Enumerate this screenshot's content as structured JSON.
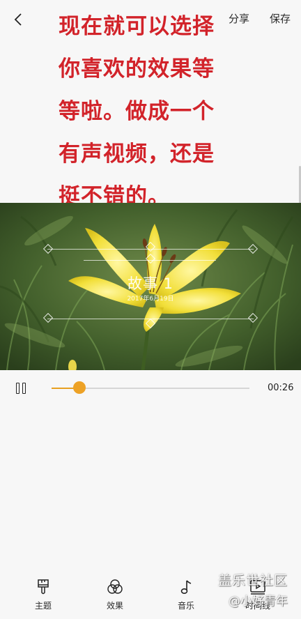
{
  "header": {
    "share_label": "分享",
    "save_label": "保存"
  },
  "overlay_text": [
    "现在就可以选择",
    "你喜欢的效果等",
    "等啦。做成一个",
    "有声视频，还是",
    "挺不错的。"
  ],
  "preview": {
    "story_title": "故事 1",
    "story_date": "2017年6月19日"
  },
  "playback": {
    "progress": 0.14,
    "time": "00:26",
    "accent_color": "#eda226"
  },
  "nav": {
    "items": [
      {
        "label": "主题",
        "icon": "brush-icon"
      },
      {
        "label": "效果",
        "icon": "circles-icon"
      },
      {
        "label": "音乐",
        "icon": "music-note-icon"
      },
      {
        "label": "时间线",
        "icon": "timeline-icon"
      }
    ]
  },
  "watermark": {
    "line1": "盖乐世社区",
    "line2": "@小好青年"
  },
  "colors": {
    "overlay_text": "#d2232a",
    "background": "#f7f7f7"
  }
}
